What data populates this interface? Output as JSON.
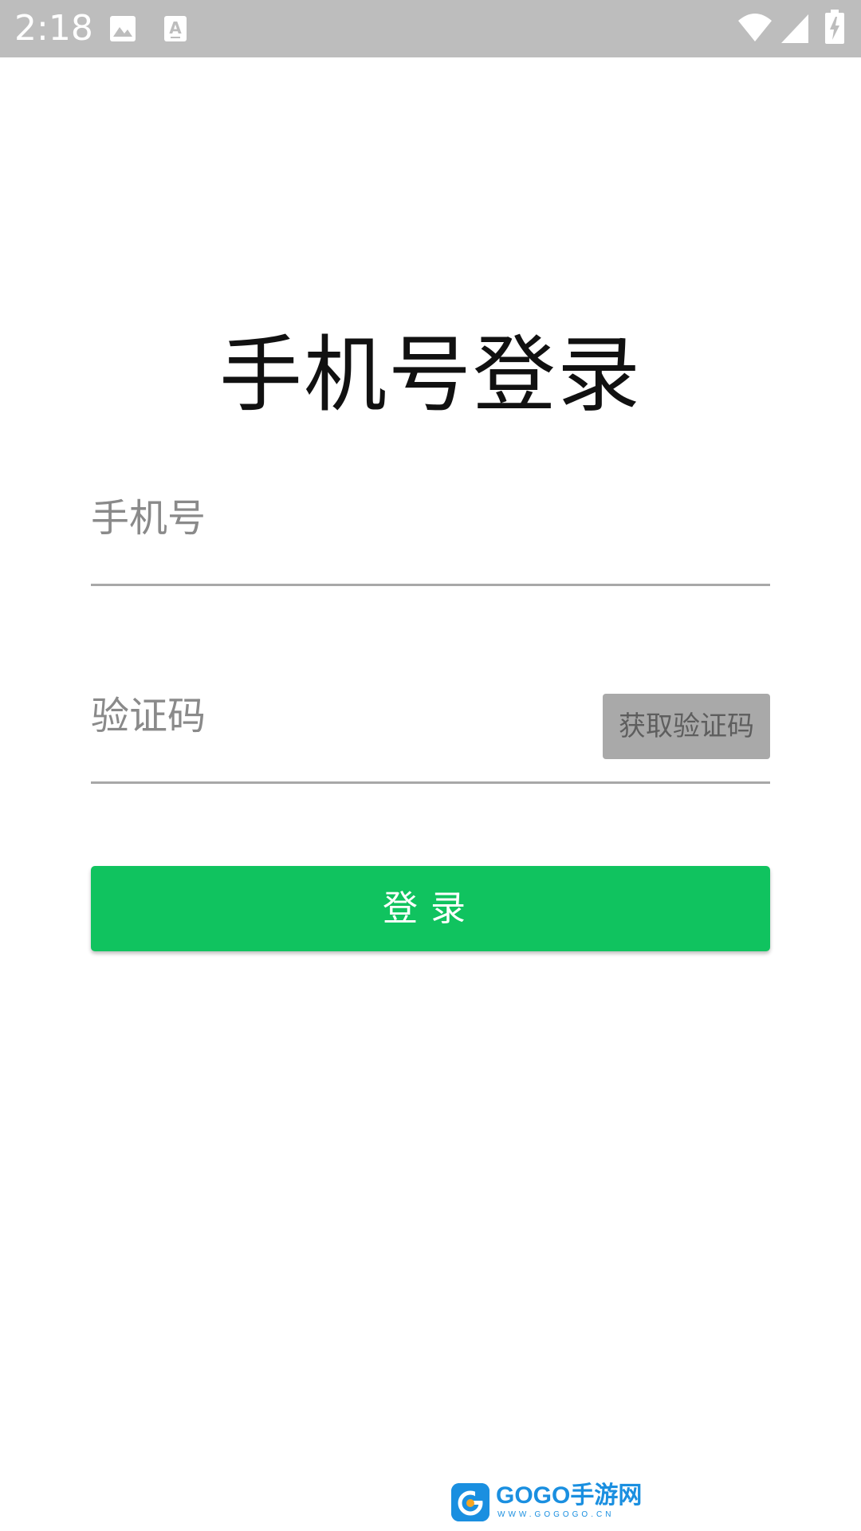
{
  "status_bar": {
    "time": "2:18",
    "icons": [
      "image-icon",
      "text-a-icon",
      "wifi-icon",
      "signal-icon",
      "battery-charging-icon"
    ]
  },
  "page": {
    "title": "手机号登录"
  },
  "form": {
    "phone": {
      "value": "",
      "placeholder": "手机号"
    },
    "code": {
      "value": "",
      "placeholder": "验证码"
    },
    "get_code_label": "获取验证码",
    "login_label": "登录"
  },
  "watermark": {
    "brand": "GOGO手游网",
    "url": "WWW.GOGOGO.CN"
  },
  "colors": {
    "status_bar_bg": "#bdbdbd",
    "primary_green": "#10c35f",
    "disabled_button_bg": "#a9a9a9",
    "underline": "#a8a8a8"
  }
}
